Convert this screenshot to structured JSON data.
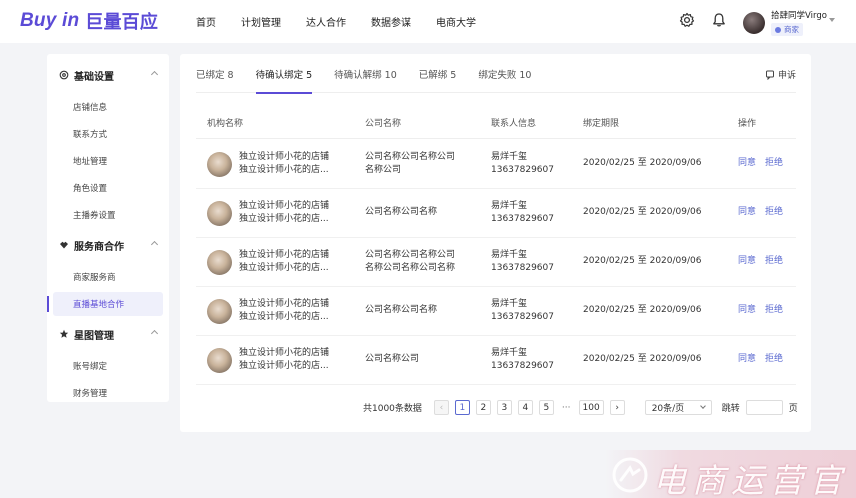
{
  "header": {
    "logo_latin": "Buy in",
    "logo_cn": "巨量百应",
    "nav": [
      "首页",
      "计划管理",
      "达人合作",
      "数据参谋",
      "电商大学"
    ],
    "user_name": "拾肆同学Virgo",
    "user_role": "商家"
  },
  "sidebar": {
    "groups": [
      {
        "title": "基础设置",
        "icon": "settings-icon",
        "items": [
          "店铺信息",
          "联系方式",
          "地址管理",
          "角色设置",
          "主播券设置"
        ]
      },
      {
        "title": "服务商合作",
        "icon": "handshake-icon",
        "items": [
          "商家服务商",
          "直播基地合作"
        ]
      },
      {
        "title": "星图管理",
        "icon": "star-icon",
        "items": [
          "账号绑定",
          "财务管理"
        ]
      }
    ],
    "active_item": "直播基地合作"
  },
  "tabs": [
    {
      "label": "已绑定 8",
      "active": false
    },
    {
      "label": "待确认绑定 5",
      "active": true
    },
    {
      "label": "待确认解绑 10",
      "active": false
    },
    {
      "label": "已解绑 5",
      "active": false
    },
    {
      "label": "绑定失败 10",
      "active": false
    }
  ],
  "complain_label": "申诉",
  "table": {
    "columns": [
      "机构名称",
      "公司名称",
      "联系人信息",
      "绑定期限",
      "操作"
    ],
    "rows": [
      {
        "org_line1": "独立设计师小花的店铺",
        "org_line2": "独立设计师小花的店...",
        "company_line1": "公司名称公司名称公司",
        "company_line2": "名称公司",
        "contact_name": "易烊千玺",
        "contact_phone": "13637829607",
        "period": "2020/02/25 至 2020/09/06",
        "accept": "同意",
        "reject": "拒绝"
      },
      {
        "org_line1": "独立设计师小花的店铺",
        "org_line2": "独立设计师小花的店...",
        "company_line1": "公司名称公司名称",
        "company_line2": "",
        "contact_name": "易烊千玺",
        "contact_phone": "13637829607",
        "period": "2020/02/25 至 2020/09/06",
        "accept": "同意",
        "reject": "拒绝"
      },
      {
        "org_line1": "独立设计师小花的店铺",
        "org_line2": "独立设计师小花的店...",
        "company_line1": "公司名称公司名称公司",
        "company_line2": "名称公司名称公司名称",
        "contact_name": "易烊千玺",
        "contact_phone": "13637829607",
        "period": "2020/02/25 至 2020/09/06",
        "accept": "同意",
        "reject": "拒绝"
      },
      {
        "org_line1": "独立设计师小花的店铺",
        "org_line2": "独立设计师小花的店...",
        "company_line1": "公司名称公司名称",
        "company_line2": "",
        "contact_name": "易烊千玺",
        "contact_phone": "13637829607",
        "period": "2020/02/25 至 2020/09/06",
        "accept": "同意",
        "reject": "拒绝"
      },
      {
        "org_line1": "独立设计师小花的店铺",
        "org_line2": "独立设计师小花的店...",
        "company_line1": "公司名称公司",
        "company_line2": "",
        "contact_name": "易烊千玺",
        "contact_phone": "13637829607",
        "period": "2020/02/25 至 2020/09/06",
        "accept": "同意",
        "reject": "拒绝"
      }
    ]
  },
  "pagination": {
    "total": "共1000条数据",
    "pages": [
      "1",
      "2",
      "3",
      "4",
      "5"
    ],
    "current": "1",
    "ellipsis": "···",
    "last": "100",
    "page_size": "20条/页",
    "jump_label": "跳转",
    "page_unit": "页"
  },
  "watermark": "电商运营官",
  "colors": {
    "accent": "#5b4bd6",
    "link": "#5b6ad0"
  }
}
